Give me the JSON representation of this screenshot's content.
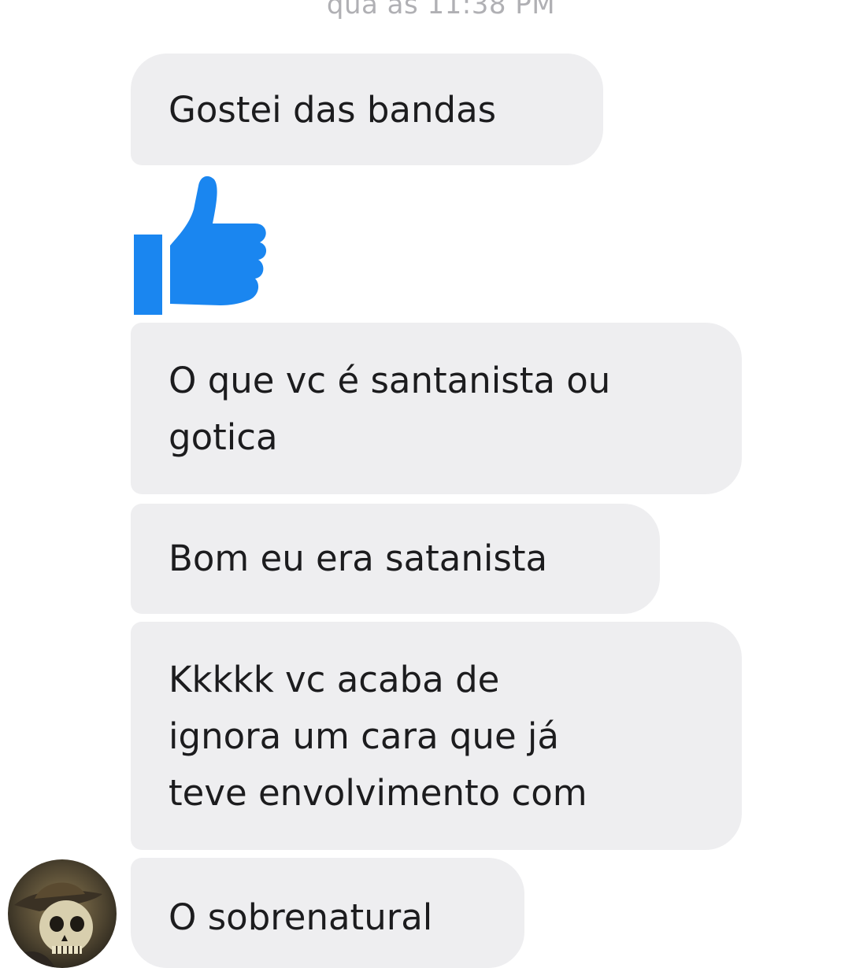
{
  "conversation": {
    "timestamp": "qua às 11:38 PM",
    "messages": [
      {
        "lines": [
          "Gostei das bandas"
        ]
      },
      {
        "lines": [
          "O que vc é santanista ou",
          "gotica"
        ]
      },
      {
        "lines": [
          "Bom eu era satanista"
        ]
      },
      {
        "lines": [
          "Kkkkk vc acaba de",
          "ignora um cara que já",
          "teve envolvimento com"
        ]
      },
      {
        "lines": [
          "O sobrenatural"
        ]
      }
    ],
    "like_icon": "thumbs-up-icon",
    "avatar_icon": "skeleton-avatar"
  },
  "colors": {
    "bubble_bg": "#eeeef0",
    "like_blue": "#1a86f0",
    "text": "#1c1c1e",
    "timestamp": "#b0b0b4"
  }
}
